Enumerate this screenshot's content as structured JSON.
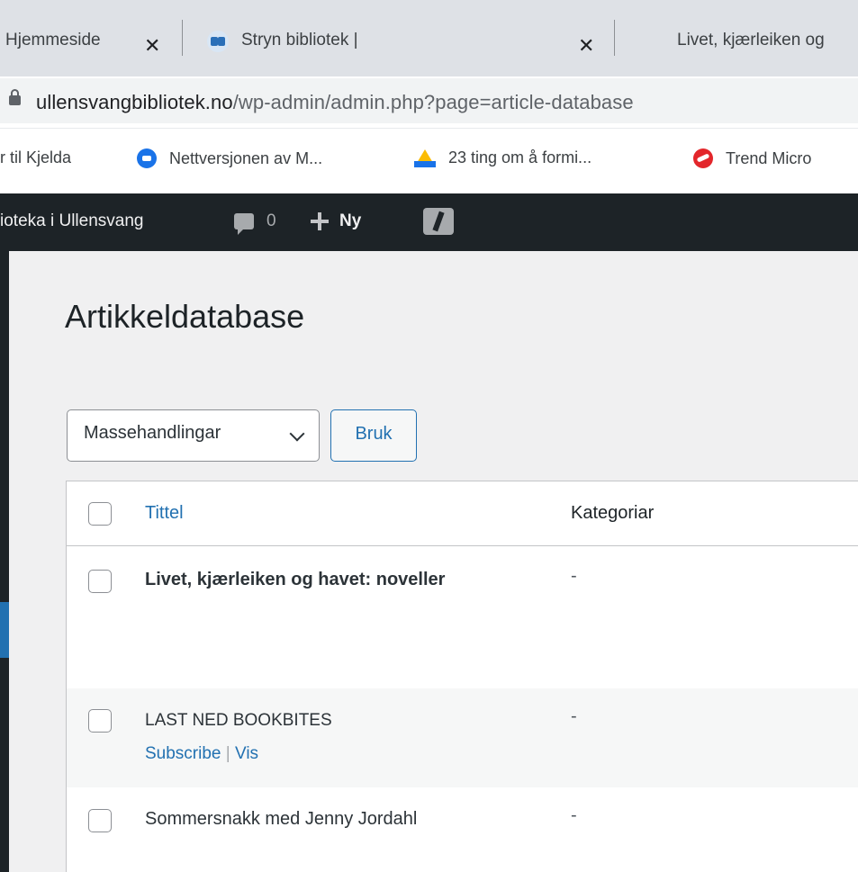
{
  "browser": {
    "tabs": [
      {
        "label": "Hjemmeside",
        "active": false
      },
      {
        "label": "Stryn bibliotek |",
        "active": false
      },
      {
        "label": "Livet, kjærleiken og",
        "active": false
      }
    ],
    "url_host": "ullensvangbibliotek.no",
    "url_path": "/wp-admin/admin.php?page=article-database",
    "bookmarks": [
      {
        "label": "r til Kjelda",
        "icon": "none"
      },
      {
        "label": "Nettversjonen av M...",
        "icon": "messages-icon"
      },
      {
        "label": "23 ting om å formi...",
        "icon": "google-drive-icon"
      },
      {
        "label": "Trend Micro",
        "icon": "trend-micro-icon"
      }
    ]
  },
  "admin_bar": {
    "site_name": "ioteka i Ullensvang",
    "comment_count": "0",
    "new_label": "Ny"
  },
  "page": {
    "title": "Artikkeldatabase",
    "bulk_actions": "Massehandlingar",
    "apply": "Bruk"
  },
  "table": {
    "columns": {
      "title": "Tittel",
      "categories": "Kategoriar"
    },
    "rows": [
      {
        "title": "Livet, kjærleiken og havet: noveller",
        "category": "-"
      },
      {
        "title": "LAST NED BOOKBITES",
        "category": "-",
        "action_subscribe": "Subscribe",
        "action_sep": "|",
        "action_view": "Vis"
      },
      {
        "title": "Sommersnakk med Jenny Jordahl",
        "category": "-"
      }
    ]
  },
  "colors": {
    "wp_dark": "#1d2327",
    "wp_blue": "#2271b1",
    "admin_bg": "#f0f0f1"
  }
}
